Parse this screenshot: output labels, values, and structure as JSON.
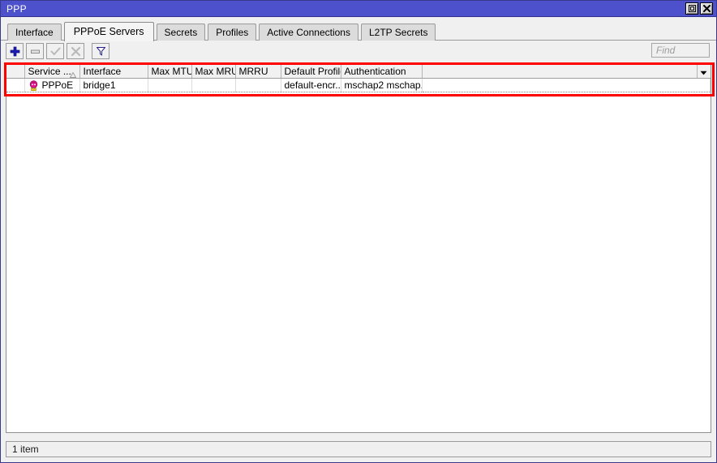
{
  "window": {
    "title": "PPP",
    "titlebar_color": "#4d51cc",
    "buttons": [
      {
        "name": "maximize-button",
        "icon": "maximize-icon",
        "label": "Maximize"
      },
      {
        "name": "close-button",
        "icon": "close-icon",
        "label": "Close"
      }
    ]
  },
  "tabs": [
    {
      "label": "Interface",
      "active": false
    },
    {
      "label": "PPPoE Servers",
      "active": true
    },
    {
      "label": "Secrets",
      "active": false
    },
    {
      "label": "Profiles",
      "active": false
    },
    {
      "label": "Active Connections",
      "active": false
    },
    {
      "label": "L2TP Secrets",
      "active": false
    }
  ],
  "toolbar": {
    "buttons": [
      {
        "name": "add-button",
        "icon": "plus-icon",
        "label": "Add",
        "enabled": true
      },
      {
        "name": "remove-button",
        "icon": "minus-icon",
        "label": "Remove",
        "enabled": false
      },
      {
        "name": "enable-button",
        "icon": "check-icon",
        "label": "Enable",
        "enabled": false
      },
      {
        "name": "disable-button",
        "icon": "cross-icon",
        "label": "Disable",
        "enabled": false
      },
      {
        "name": "filter-button",
        "icon": "funnel-icon",
        "label": "Filter",
        "enabled": true
      }
    ],
    "find_placeholder": "Find"
  },
  "table": {
    "columns": [
      {
        "key": "flag",
        "label": ""
      },
      {
        "key": "service",
        "label": "Service ...",
        "sorted": "asc"
      },
      {
        "key": "interface",
        "label": "Interface"
      },
      {
        "key": "max_mtu",
        "label": "Max MTU"
      },
      {
        "key": "max_mru",
        "label": "Max MRU"
      },
      {
        "key": "mrru",
        "label": "MRRU"
      },
      {
        "key": "default_profile",
        "label": "Default Profile"
      },
      {
        "key": "authentication",
        "label": "Authentication"
      },
      {
        "key": "spare",
        "label": ""
      }
    ],
    "rows": [
      {
        "flag": "",
        "icon": "pppoe-server-icon",
        "service": "PPPoE",
        "interface": "bridge1",
        "max_mtu": "",
        "max_mru": "",
        "mrru": "",
        "default_profile": "default-encr...",
        "authentication": "mschap2 mschap...",
        "spare": ""
      }
    ]
  },
  "statusbar": {
    "item_count_label": "1 item"
  },
  "annotation": {
    "highlight_color": "#ff0000",
    "target": "pppoe-servers-table-highlight"
  }
}
